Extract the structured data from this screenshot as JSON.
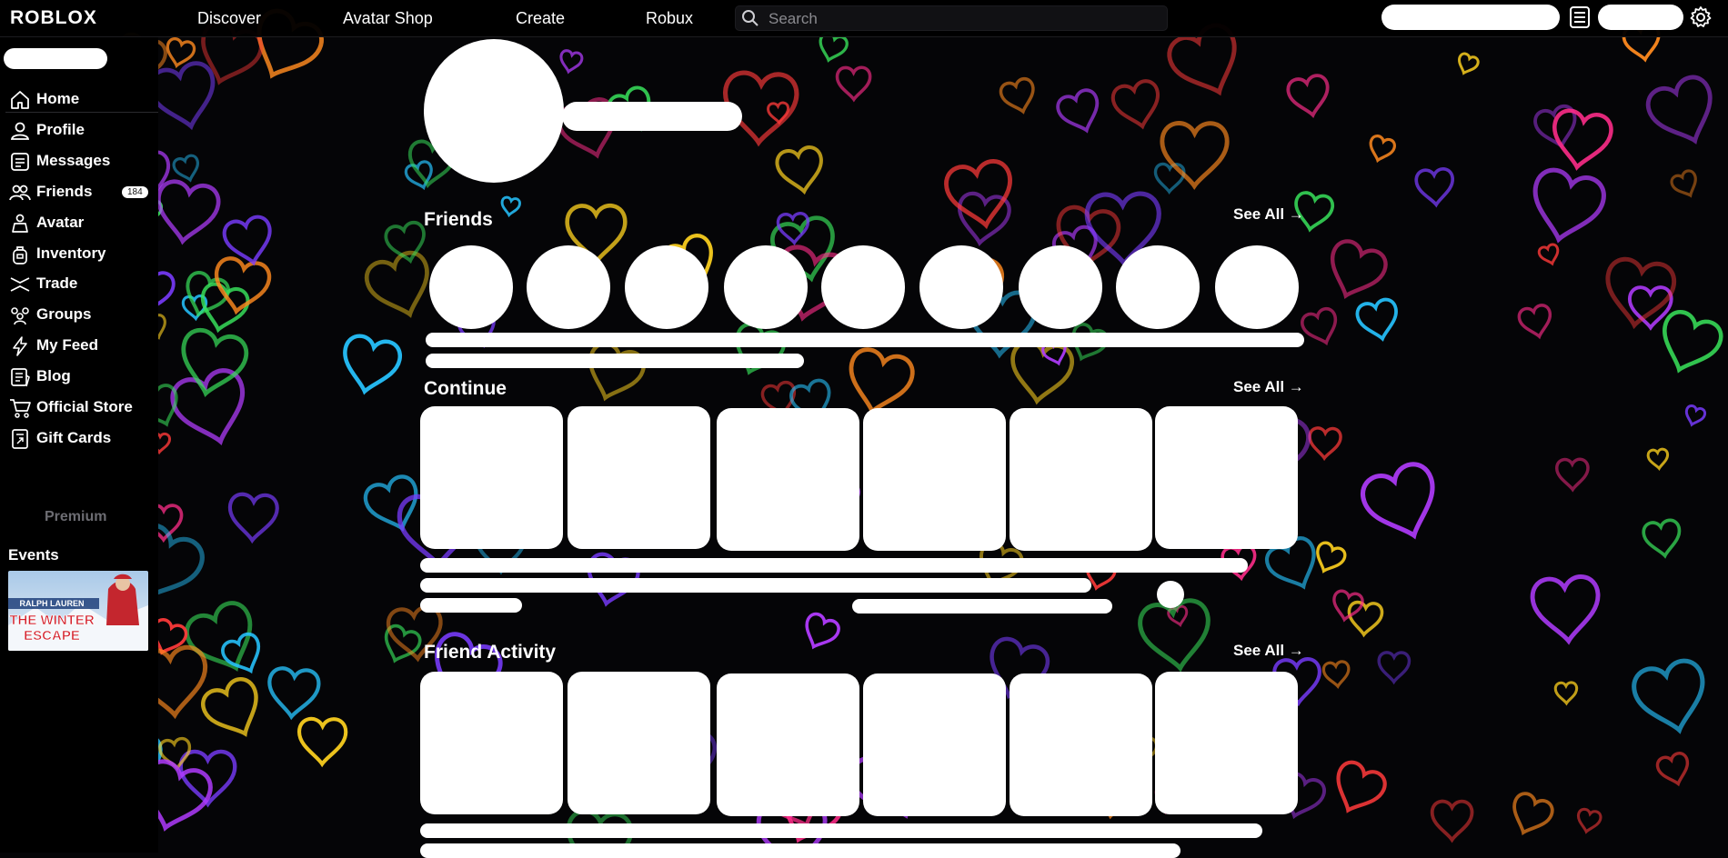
{
  "header": {
    "logo": "ROBLOX",
    "nav": [
      "Discover",
      "Avatar Shop",
      "Create",
      "Robux"
    ],
    "search_placeholder": "Search"
  },
  "sidebar": {
    "items": [
      {
        "label": "Home",
        "icon": "home-icon"
      },
      {
        "label": "Profile",
        "icon": "profile-icon"
      },
      {
        "label": "Messages",
        "icon": "messages-icon"
      },
      {
        "label": "Friends",
        "icon": "friends-icon",
        "badge": "184"
      },
      {
        "label": "Avatar",
        "icon": "avatar-icon"
      },
      {
        "label": "Inventory",
        "icon": "inventory-icon"
      },
      {
        "label": "Trade",
        "icon": "trade-icon"
      },
      {
        "label": "Groups",
        "icon": "groups-icon"
      },
      {
        "label": "My Feed",
        "icon": "feed-icon"
      },
      {
        "label": "Blog",
        "icon": "blog-icon"
      },
      {
        "label": "Official Store",
        "icon": "store-icon"
      },
      {
        "label": "Gift Cards",
        "icon": "gift-card-icon"
      }
    ],
    "premium": "Premium",
    "events_title": "Events",
    "event_banner": {
      "brand": "RALPH LAUREN",
      "line1": "THE WINTER",
      "line2": "ESCAPE"
    }
  },
  "main": {
    "friends_title": "Friends",
    "continue_title": "Continue",
    "activity_title": "Friend Activity",
    "see_all": "See All →"
  },
  "colors": {
    "background": "#050507",
    "text": "#ffffff",
    "badge_text": "#111111"
  }
}
